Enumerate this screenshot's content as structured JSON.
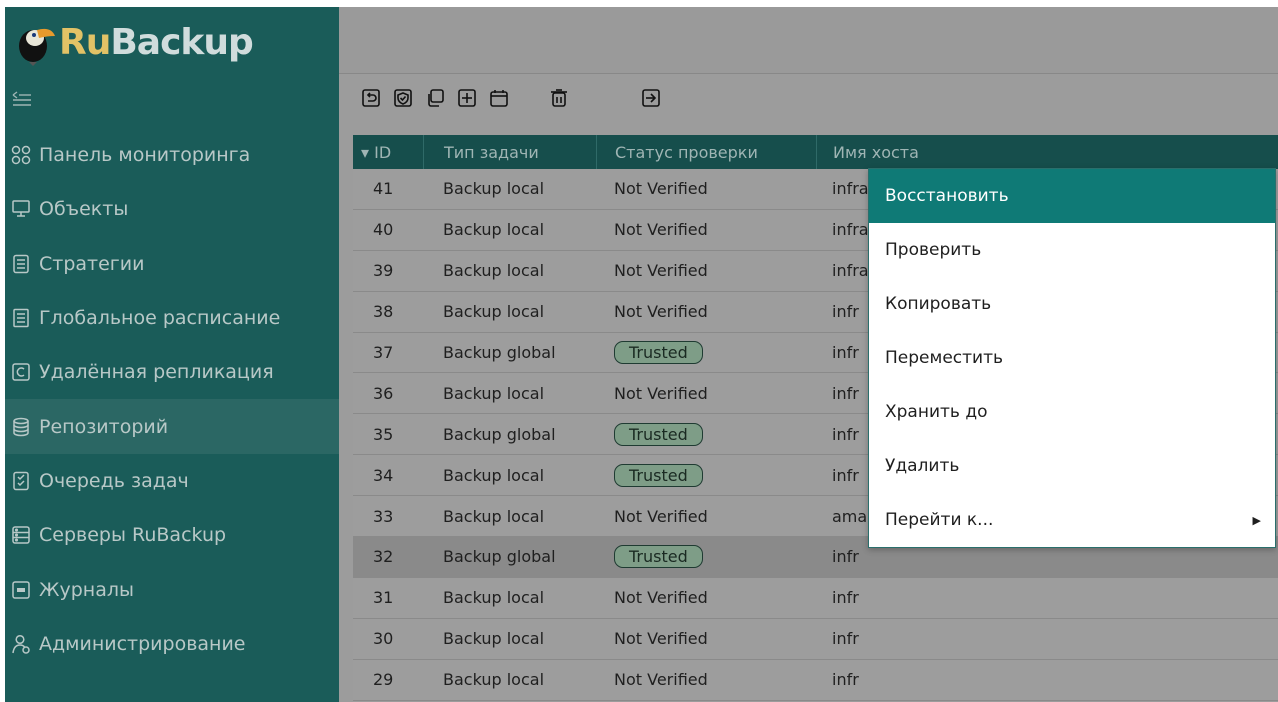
{
  "app": {
    "logo": {
      "prefix": "Ru",
      "suffix": "Backup"
    }
  },
  "sidebar": {
    "items": [
      {
        "label": "Панель мониторинга",
        "icon": "dashboard-icon"
      },
      {
        "label": "Объекты",
        "icon": "monitor-icon"
      },
      {
        "label": "Стратегии",
        "icon": "document-icon"
      },
      {
        "label": "Глобальное расписание",
        "icon": "schedule-icon"
      },
      {
        "label": "Удалённая репликация",
        "icon": "replication-icon"
      },
      {
        "label": "Репозиторий",
        "icon": "database-icon",
        "active": true
      },
      {
        "label": "Очередь задач",
        "icon": "checklist-icon"
      },
      {
        "label": "Серверы RuBackup",
        "icon": "server-icon"
      },
      {
        "label": "Журналы",
        "icon": "log-icon"
      },
      {
        "label": "Администрирование",
        "icon": "admin-user-icon"
      }
    ]
  },
  "table": {
    "columns": {
      "id": "▾ ID",
      "type": "Тип задачи",
      "status": "Статус проверки",
      "host": "Имя хоста"
    },
    "rows": [
      {
        "id": "41",
        "type": "Backup local",
        "status": "Not Verified",
        "host": "infra"
      },
      {
        "id": "40",
        "type": "Backup local",
        "status": "Not Verified",
        "host": "infra"
      },
      {
        "id": "39",
        "type": "Backup local",
        "status": "Not Verified",
        "host": "infra"
      },
      {
        "id": "38",
        "type": "Backup local",
        "status": "Not Verified",
        "host": "infr"
      },
      {
        "id": "37",
        "type": "Backup global",
        "status": "Trusted",
        "host": "infr"
      },
      {
        "id": "36",
        "type": "Backup local",
        "status": "Not Verified",
        "host": "infr"
      },
      {
        "id": "35",
        "type": "Backup global",
        "status": "Trusted",
        "host": "infr"
      },
      {
        "id": "34",
        "type": "Backup local",
        "status": "Trusted",
        "host": "infr"
      },
      {
        "id": "33",
        "type": "Backup local",
        "status": "Not Verified",
        "host": "ama"
      },
      {
        "id": "32",
        "type": "Backup global",
        "status": "Trusted",
        "host": "infr",
        "selected": true
      },
      {
        "id": "31",
        "type": "Backup local",
        "status": "Not Verified",
        "host": "infr"
      },
      {
        "id": "30",
        "type": "Backup local",
        "status": "Not Verified",
        "host": "infr"
      },
      {
        "id": "29",
        "type": "Backup local",
        "status": "Not Verified",
        "host": "infr"
      }
    ]
  },
  "context_menu": {
    "items": [
      {
        "label": "Восстановить",
        "highlighted": true
      },
      {
        "label": "Проверить"
      },
      {
        "label": "Копировать"
      },
      {
        "label": "Переместить"
      },
      {
        "label": "Хранить до"
      },
      {
        "label": "Удалить"
      },
      {
        "label": "Перейти к...",
        "submenu": true
      }
    ]
  },
  "colors": {
    "sidebar_bg": "#1a5c59",
    "accent": "#0f7a76",
    "overlay": "#9c9c9c",
    "trusted_badge": "#7e9d87"
  }
}
